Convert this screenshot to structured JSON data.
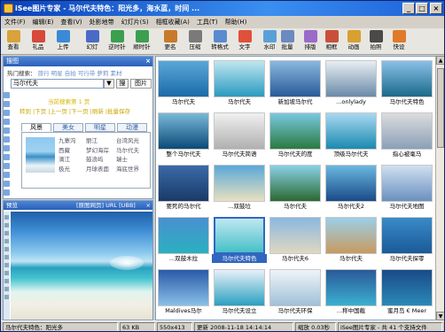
{
  "window": {
    "title": "iSee图片专家 - 马尔代夫特色：阳光多，海水蓝，时间 ...",
    "min": "_",
    "max": "□",
    "close": "×"
  },
  "menu": [
    "文件(F)",
    "编辑(E)",
    "查看(V)",
    "处影地带",
    "幻灯片(S)",
    "相框收藏(A)",
    "工具(T)",
    "帮助(H)"
  ],
  "toolbar": [
    {
      "label": "查看",
      "icon": "folder-icon",
      "color": "#d9a23a"
    },
    {
      "label": "礼品",
      "icon": "gift-icon",
      "color": "#d84a3a"
    },
    {
      "label": "上传",
      "icon": "upload-icon",
      "color": "#3a8ad8"
    },
    {
      "label": "幻灯",
      "icon": "slideshow-icon",
      "color": "#4a6ac8"
    },
    {
      "label": "逆时针",
      "icon": "rotate-left-icon",
      "color": "#3aa050"
    },
    {
      "label": "顺时针",
      "icon": "rotate-right-icon",
      "color": "#3aa050"
    },
    {
      "label": "更名",
      "icon": "rename-icon",
      "color": "#c87a2a"
    },
    {
      "label": "压缩",
      "icon": "compress-icon",
      "color": "#7a7a7a"
    },
    {
      "label": "转格式",
      "icon": "convert-icon",
      "color": "#5a8ad0"
    },
    {
      "label": "文字",
      "icon": "text-icon",
      "color": "#e0503a"
    },
    {
      "label": "水印",
      "icon": "watermark-icon",
      "color": "#5aa0d8"
    },
    {
      "label": "批量",
      "icon": "batch-icon",
      "color": "#6a8ac0"
    },
    {
      "label": "排版",
      "icon": "layout-icon",
      "color": "#9a6ac8"
    },
    {
      "label": "相框",
      "icon": "frame-icon",
      "color": "#c8503a"
    },
    {
      "label": "动画",
      "icon": "animation-icon",
      "color": "#d8a030"
    },
    {
      "label": "拍照",
      "icon": "camera-icon",
      "color": "#4a4a4a"
    },
    {
      "label": "快设",
      "icon": "quickset-icon",
      "color": "#e07a2a"
    }
  ],
  "search_panel": {
    "header": "搜图",
    "hot_label": "热门搜索：",
    "hot_links": [
      "旅行",
      "明星",
      "自拍",
      "可行带",
      "萝莉",
      "素材"
    ],
    "search_value": "马尔代夫",
    "search_btn": "▼",
    "go_btn": "搜",
    "engine": "图片",
    "current_line": "当前搜索第 1 页",
    "nav": [
      "转到",
      "下页",
      "上一页",
      "下一页",
      "刷新",
      "批量保存"
    ],
    "cat_tabs": [
      "风景",
      "美女",
      "明星",
      "动漫"
    ],
    "cat_col1": [
      "九寨沟",
      "西藏",
      "漓江",
      "极光"
    ],
    "cat_col2": [
      "丽江",
      "梦幻海岸",
      "鼓浪屿",
      "月球表面"
    ],
    "cat_col3": [
      "台湾风光",
      "马尔代夫",
      "瑞士",
      "海底世界"
    ],
    "tabs": [
      "文件夹",
      "搜图",
      "相册",
      "我的分区"
    ]
  },
  "preview": {
    "title": "预览",
    "links": "[原图网页] URL [UBB]",
    "close": "×"
  },
  "thumbnails": [
    {
      "caption": "马尔代夫",
      "a": "#5aa8d8",
      "b": "#1c6aa8"
    },
    {
      "caption": "马尔代夫",
      "a": "#bfe6f0",
      "b": "#2a9ac0"
    },
    {
      "caption": "新加坡马尔代",
      "a": "#8ab8e0",
      "b": "#2a5a98"
    },
    {
      "caption": "...onlylady",
      "a": "#e8eef4",
      "b": "#6a8aa8"
    },
    {
      "caption": "马尔代夫特色",
      "a": "#8ac0e8",
      "b": "#1a6a8a"
    },
    {
      "caption": "整个马尔代夫",
      "a": "#7ab8d8",
      "b": "#0a4a78"
    },
    {
      "caption": "马尔代夫简语",
      "a": "#f0f0f0",
      "b": "#b0b0b0"
    },
    {
      "caption": "马尔代夫的度",
      "a": "#7ac8e0",
      "b": "#2a7a40"
    },
    {
      "caption": "顶级马尔代夫",
      "a": "#a8d8f0",
      "b": "#1a8ab0"
    },
    {
      "caption": "指心被毫马",
      "a": "#dcdcdc",
      "b": "#8aa0b8"
    },
    {
      "caption": "要死的马尔代",
      "a": "#3a6aa8",
      "b": "#1a3a68"
    },
    {
      "caption": "...双鼓垃",
      "a": "#5aa8d8",
      "b": "#e8e0c0"
    },
    {
      "caption": "马尔代夫",
      "a": "#8ad0e8",
      "b": "#2a6a30"
    },
    {
      "caption": "马尔代夫2",
      "a": "#6ab8e0",
      "b": "#1a4a88"
    },
    {
      "caption": "马尔代夫地图",
      "a": "#d0e0f0",
      "b": "#6a90c0"
    },
    {
      "caption": "...双鼓木拉",
      "a": "#4a90d0",
      "b": "#2ab0c0"
    },
    {
      "caption": "马尔代夫特色",
      "a": "#bfe8f0",
      "b": "#46c0c8"
    },
    {
      "caption": "马尔代夫6",
      "a": "#8ab8e0",
      "b": "#e0d8c0"
    },
    {
      "caption": "马尔代夫",
      "a": "#9ad0e8",
      "b": "#c89a60"
    },
    {
      "caption": "马尔代夫探零",
      "a": "#3a8ac8",
      "b": "#1a5a98"
    },
    {
      "caption": "Maldives马尔",
      "a": "#2a5aa8",
      "b": "#8ac0e8"
    },
    {
      "caption": "马尔代夫设立",
      "a": "#e8f0f8",
      "b": "#2aa0c0"
    },
    {
      "caption": "马尔代夫环保",
      "a": "#f0f4f8",
      "b": "#a0c0d8"
    },
    {
      "caption": "...称中国截",
      "a": "#2a5a98",
      "b": "#3ab0d0"
    },
    {
      "caption": "蜜月岛 € Meer",
      "a": "#1a4a88",
      "b": "#2a8ab8"
    }
  ],
  "selected_index": 16,
  "status": {
    "desc": "马尔代夫特色：阳光多",
    "size": "63 KB",
    "dims": "550x413",
    "date": "更新 2008-11-18 14:14:14",
    "zoom": "缩放 0.03秒",
    "info": "iSee图片专家 - 共 41 个支持文件"
  }
}
